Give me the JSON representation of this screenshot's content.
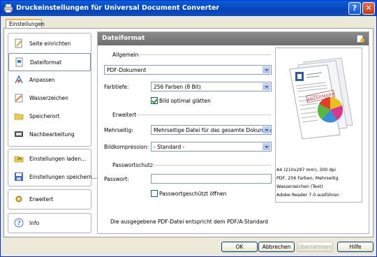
{
  "window": {
    "title": "Druckeinstellungen für Universal Document Converter",
    "help_glyph": "?",
    "close_glyph": "✕"
  },
  "tab_label": "Einstellungen",
  "nav": {
    "group1": [
      {
        "label": "Seite einrichten",
        "icon": "page-setup-icon"
      },
      {
        "label": "Dateiformat",
        "icon": "file-format-icon",
        "selected": true
      },
      {
        "label": "Anpassen",
        "icon": "adjust-icon"
      },
      {
        "label": "Wasserzeichen",
        "icon": "watermark-icon"
      },
      {
        "label": "Speicherort",
        "icon": "save-location-icon"
      },
      {
        "label": "Nachbearbeitung",
        "icon": "post-processing-icon"
      }
    ],
    "group2": [
      {
        "label": "Einstellungen laden...",
        "icon": "load-settings-icon"
      },
      {
        "label": "Einstellungen speichern...",
        "icon": "save-settings-icon"
      }
    ],
    "group3": [
      {
        "label": "Erweitert",
        "icon": "advanced-icon"
      }
    ],
    "group4": [
      {
        "label": "Info",
        "icon": "info-icon"
      }
    ]
  },
  "panel": {
    "title": "Dateiformat",
    "general": {
      "section_label": "Allgemein",
      "format_value": "PDF-Dokument",
      "color_depth_label": "Farbtiefe:",
      "color_depth_value": "256 Farben (8 Bit)",
      "smooth_label": "Bild optimal glätten",
      "smooth_checked": true
    },
    "advanced": {
      "section_label": "Erweitert",
      "multipage_label": "Mehrseitig:",
      "multipage_value": "Mehrseitige Datei für das gesamte Dokument",
      "compression_label": "Bildkompression:",
      "compression_value": "- Standard -"
    },
    "password": {
      "section_label": "Passwortschutz",
      "password_label": "Passwort:",
      "password_value": "",
      "protect_label": "Passwortgeschützt öffnen",
      "protect_checked": false
    },
    "footer_note": "Die ausgegebene PDF-Datei entspricht dem PDF/A-Standard"
  },
  "preview": {
    "watermark_text": "WATERMARK",
    "info_lines": [
      "A4 (210x297 mm), 300 dpi",
      "PDF, 256 Farben, Mehrseitig",
      "Wasserzeichen (Text)",
      "Adobe Reader 7.0 ausführen"
    ]
  },
  "buttons": {
    "ok": "OK",
    "cancel": "Abbrechen",
    "apply": "Übernehmen",
    "help": "Hilfe"
  }
}
